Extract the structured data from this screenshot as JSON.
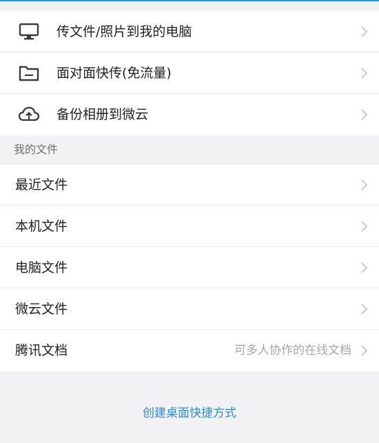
{
  "transfer_items": [
    {
      "icon": "monitor-icon",
      "label": "传文件/照片到我的电脑"
    },
    {
      "icon": "folder-icon",
      "label": "面对面快传(免流量)"
    },
    {
      "icon": "cloud-upload-icon",
      "label": "备份相册到微云"
    }
  ],
  "my_files": {
    "header": "我的文件",
    "items": [
      {
        "label": "最近文件"
      },
      {
        "label": "本机文件"
      },
      {
        "label": "电脑文件"
      },
      {
        "label": "微云文件"
      },
      {
        "label": "腾讯文档",
        "hint": "可多人协作的在线文档"
      }
    ]
  },
  "footer": {
    "shortcut_label": "创建桌面快捷方式"
  },
  "colors": {
    "accent": "#1e9bf0",
    "link": "#2a8fd6",
    "background": "#f2f2f4"
  }
}
